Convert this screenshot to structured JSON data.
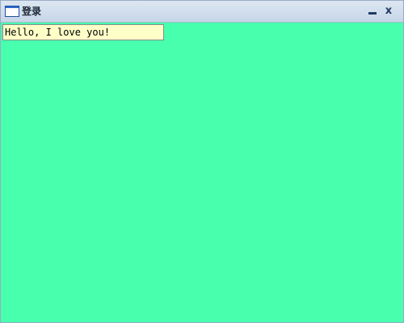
{
  "window": {
    "title": "登录",
    "icon": "app-window-icon",
    "controls": {
      "minimize_icon": "minimize-icon",
      "close_label": "x"
    }
  },
  "content": {
    "text_box": "Hello, I love you!"
  },
  "colors": {
    "client_background": "#47ffad",
    "text_box_background": "#ffffc8"
  }
}
